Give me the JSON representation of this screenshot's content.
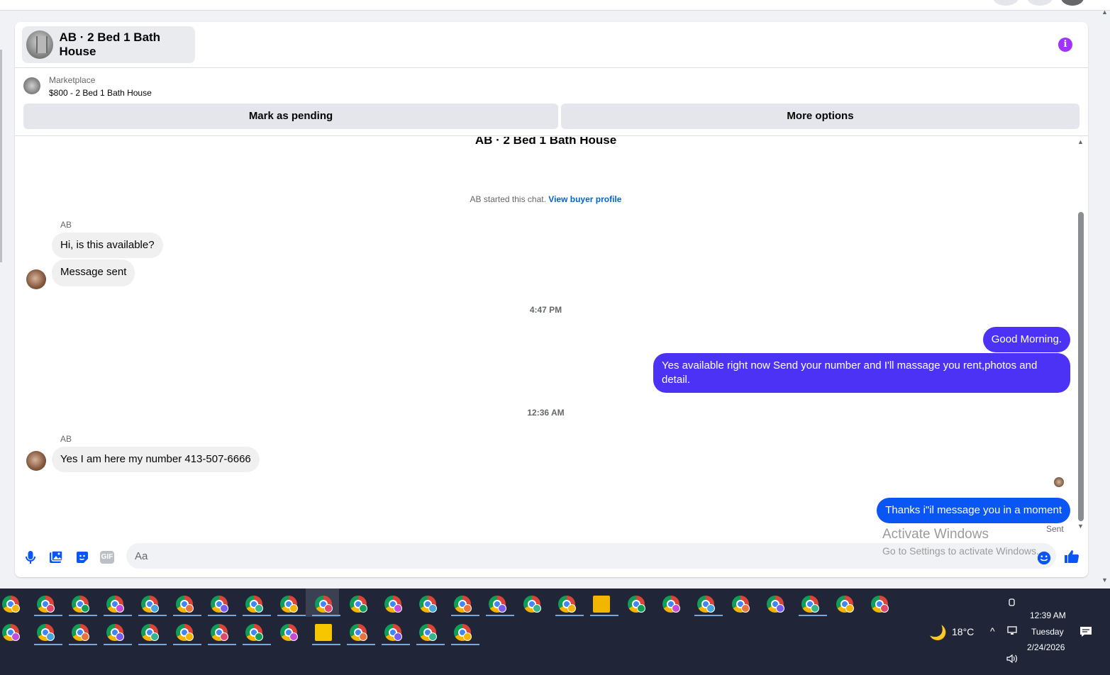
{
  "conversation": {
    "title": "AB · 2 Bed 1 Bath House",
    "info_icon": "info-icon"
  },
  "listing": {
    "type_label": "Marketplace",
    "name": "$800 - 2 Bed 1 Bath House",
    "mark_pending_label": "Mark as pending",
    "more_options_label": "More options"
  },
  "chat": {
    "title": "AB · 2 Bed 1 Bath House",
    "started_text": "AB started this chat.",
    "view_profile_label": "View buyer profile",
    "messages": [
      {
        "sender": "AB",
        "text": "Hi, is this available?",
        "direction": "incoming"
      },
      {
        "text": "Message sent",
        "direction": "incoming"
      },
      {
        "timestamp": "4:47 PM"
      },
      {
        "text": "Good Morning.",
        "direction": "outgoing"
      },
      {
        "text": "Yes available right now Send your number and I'll massage you rent,photos and detail.",
        "direction": "outgoing"
      },
      {
        "timestamp": "12:36 AM"
      },
      {
        "sender": "AB",
        "text": "Yes I am here my number 413-507-6666",
        "direction": "incoming"
      },
      {
        "text": "Thanks i\"il message you in a moment",
        "direction": "outgoing",
        "status": "Sent"
      }
    ]
  },
  "composer": {
    "placeholder": "Aa",
    "icons": [
      "microphone-icon",
      "photo-icon",
      "sticker-icon",
      "gif-icon",
      "emoji-icon",
      "thumbs-up-icon"
    ],
    "gif_label": "GIF"
  },
  "watermark": {
    "line1": "Activate Windows",
    "line2": "Go to Settings to activate Windows."
  },
  "taskbar": {
    "weather": "18°C",
    "time": "12:39 AM",
    "day": "Tuesday",
    "date": "2/24/2026"
  },
  "colors": {
    "outgoing_bubble": "#4c32f5",
    "outgoing_bubble_last": "#0a56f5",
    "link": "#0064d1",
    "info": "#a033ff",
    "taskbar": "#202637"
  }
}
